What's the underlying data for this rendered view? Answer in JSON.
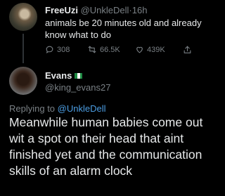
{
  "tweet1": {
    "display_name": "FreeUzi",
    "handle": "@UnkleDell",
    "separator": "·",
    "age": "16h",
    "text": "animals be 20 minutes old and already know what to do",
    "actions": {
      "reply_count": "308",
      "retweet_count": "66.5K",
      "like_count": "439K"
    }
  },
  "tweet2": {
    "display_name": "Evans",
    "handle": "@king_evans27",
    "flag_colors": [
      "#1f8a43",
      "#ffffff",
      "#1f8a43"
    ],
    "replying_prefix": "Replying to",
    "replying_to": "@UnkleDell",
    "text": "Meanwhile human babies come out wit a spot on their head that aint finished yet and the communication skills of an alarm clock"
  },
  "icons": {
    "reply": "reply-icon",
    "retweet": "retweet-icon",
    "like": "heart-icon",
    "share": "share-icon"
  },
  "colors": {
    "background": "#000000",
    "primary_text": "#e7e9ea",
    "secondary_text": "#7a8085",
    "link": "#4c9ee3"
  }
}
